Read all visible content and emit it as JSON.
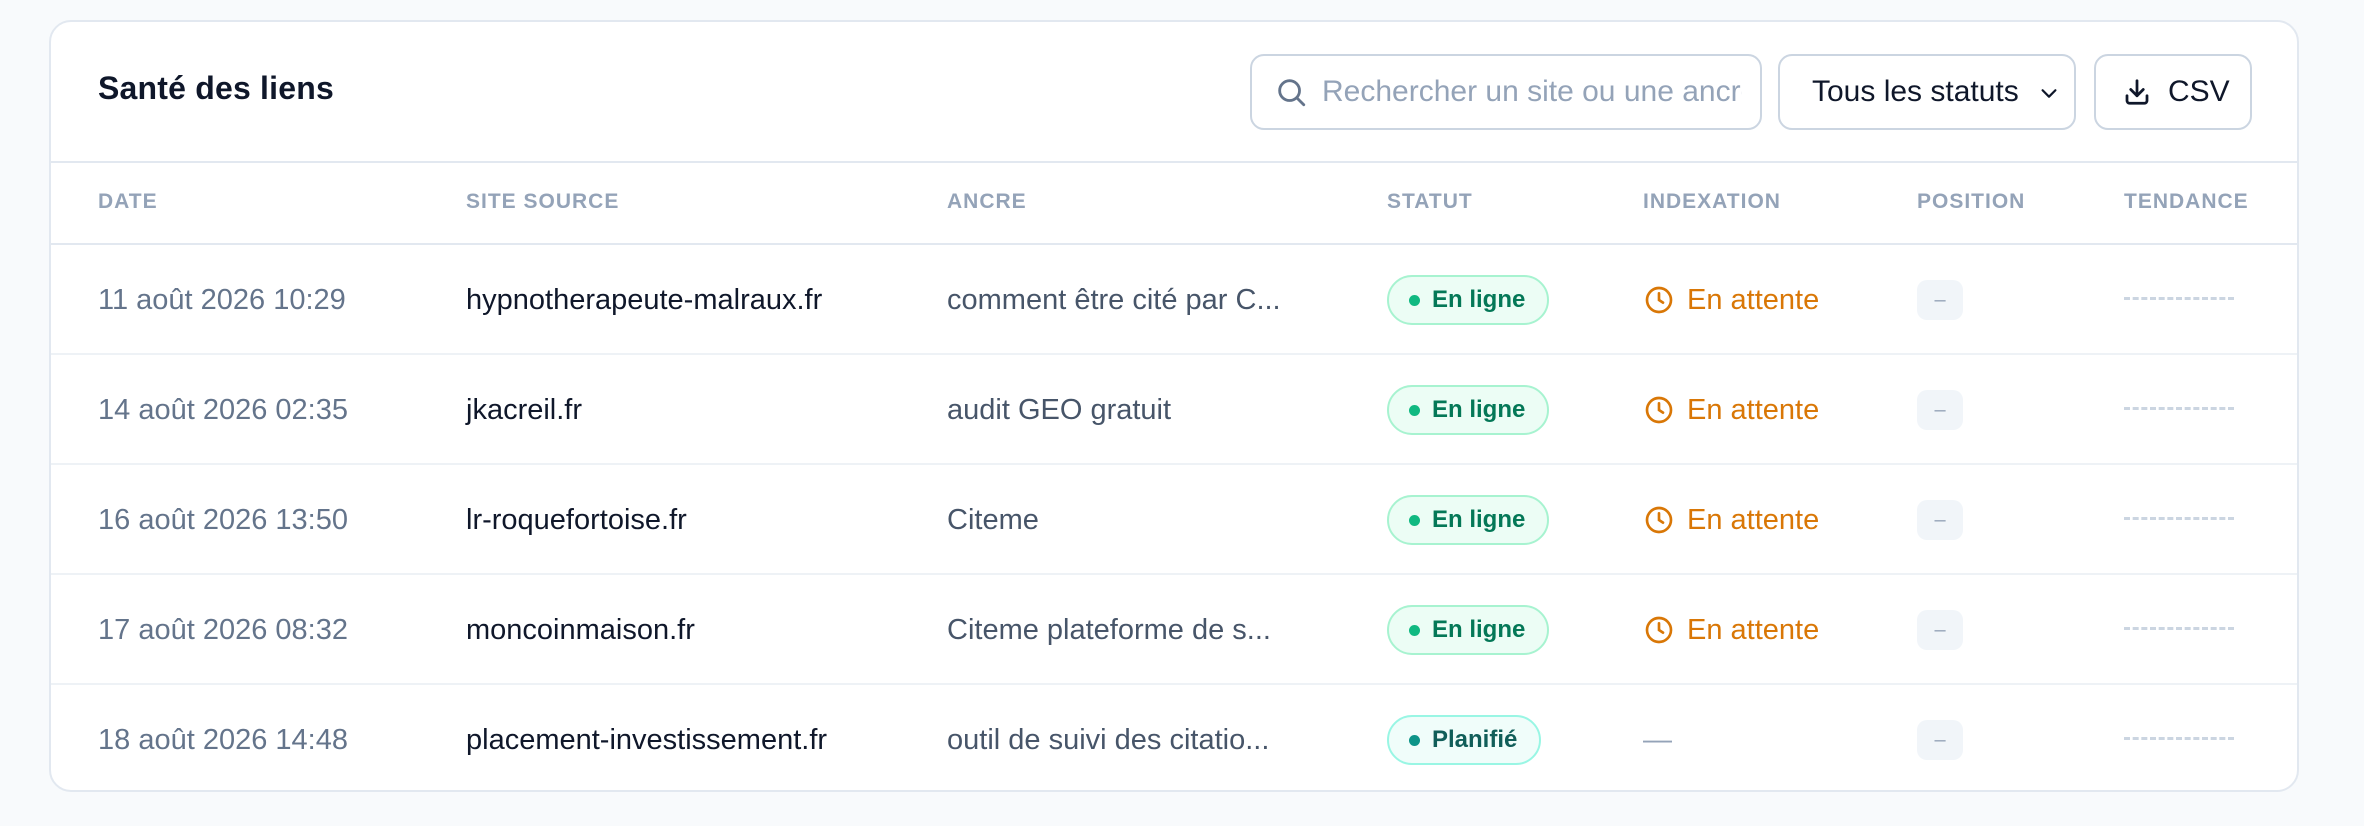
{
  "panel": {
    "title": "Santé des liens",
    "search_placeholder": "Rechercher un site ou une ancre",
    "status_filter": "Tous les statuts",
    "export_label": "CSV"
  },
  "columns": [
    "DATE",
    "SITE SOURCE",
    "ANCRE",
    "STATUT",
    "INDEXATION",
    "POSITION",
    "TENDANCE"
  ],
  "rows": [
    {
      "date": "11 août 2026 10:29",
      "site": "hypnotherapeute-malraux.fr",
      "anchor": "comment être cité par C...",
      "status": "En ligne",
      "status_type": "online",
      "indexation": "En attente",
      "position": "–"
    },
    {
      "date": "14 août 2026 02:35",
      "site": "jkacreil.fr",
      "anchor": "audit GEO gratuit",
      "status": "En ligne",
      "status_type": "online",
      "indexation": "En attente",
      "position": "–"
    },
    {
      "date": "16 août 2026 13:50",
      "site": "lr-roquefortoise.fr",
      "anchor": "Citeme",
      "status": "En ligne",
      "status_type": "online",
      "indexation": "En attente",
      "position": "–"
    },
    {
      "date": "17 août 2026 08:32",
      "site": "moncoinmaison.fr",
      "anchor": "Citeme plateforme de s...",
      "status": "En ligne",
      "status_type": "online",
      "indexation": "En attente",
      "position": "–"
    },
    {
      "date": "18 août 2026 14:48",
      "site": "placement-investissement.fr",
      "anchor": "outil de suivi des citatio...",
      "status": "Planifié",
      "status_type": "planned",
      "indexation": "—",
      "position": "–"
    }
  ],
  "colors": {
    "online": "#047857",
    "planned": "#115e59",
    "pending": "#d97706"
  }
}
